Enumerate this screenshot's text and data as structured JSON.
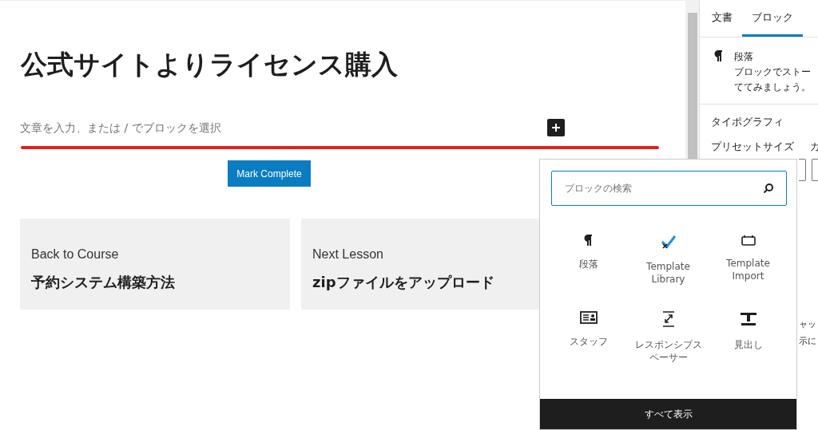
{
  "editor": {
    "title": "公式サイトよりライセンス購入",
    "placeholder": "文章を入力、または / でブロックを選択",
    "mark_complete": "Mark Complete",
    "nav_cards": [
      {
        "label": "Back to Course",
        "title": "予約システム構築方法"
      },
      {
        "label": "Next Lesson",
        "title": "zipファイルをアップロード"
      }
    ]
  },
  "sidebar": {
    "tabs": [
      {
        "label": "文書",
        "selected": false
      },
      {
        "label": "ブロック",
        "selected": true
      }
    ],
    "block_card": {
      "name": "段落",
      "description_lines": [
        "ブロックでストー",
        "ててみましょう。"
      ]
    },
    "typography": {
      "heading": "タイポグラフィ",
      "preset_label": "プリセットサイズ",
      "column_2_label": "カ"
    },
    "partial_lines": [
      "ャッ",
      "示に"
    ]
  },
  "inserter": {
    "search": {
      "placeholder": "ブロックの検索"
    },
    "blocks": [
      {
        "kind": "paragraph",
        "label": "段落"
      },
      {
        "kind": "template-library",
        "label": "Template Library"
      },
      {
        "kind": "template-import",
        "label": "Template Import"
      },
      {
        "kind": "staff",
        "label": "スタッフ"
      },
      {
        "kind": "spacer",
        "label": "レスポンシブスペーサー"
      },
      {
        "kind": "heading",
        "label": "見出し"
      }
    ],
    "show_all": "すべて表示"
  }
}
